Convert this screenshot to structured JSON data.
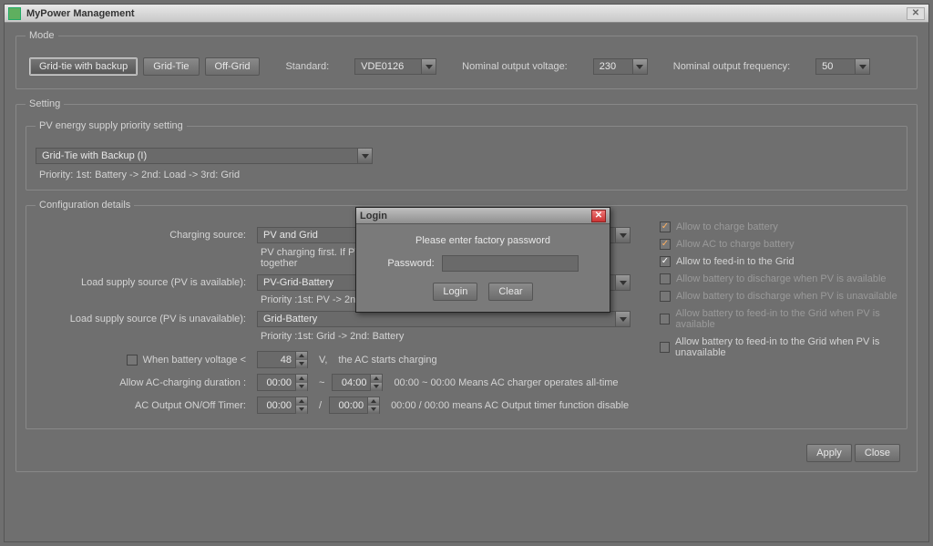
{
  "titlebar": {
    "title": "MyPower Management"
  },
  "mode": {
    "legend": "Mode",
    "buttons": {
      "backup": "Grid-tie with backup",
      "gridtie": "Grid-Tie",
      "offgrid": "Off-Grid"
    },
    "standard_label": "Standard:",
    "standard_value": "VDE0126",
    "voltage_label": "Nominal output voltage:",
    "voltage_value": "230",
    "frequency_label": "Nominal output frequency:",
    "frequency_value": "50"
  },
  "setting": {
    "legend": "Setting",
    "pv_legend": "PV energy supply priority setting",
    "pv_profile": "Grid-Tie with Backup (I)",
    "pv_priority_text": "Priority: 1st: Battery -> 2nd: Load -> 3rd: Grid",
    "config_legend": "Configuration details",
    "charging_source_label": "Charging source:",
    "charging_source_value": "PV and Grid",
    "charging_source_hint": "PV charging first. If PV power is not sufficient, PV and Grid will charge battery together",
    "load_pv_label": "Load supply source (PV is available):",
    "load_pv_value": "PV-Grid-Battery",
    "load_pv_hint": "Priority :1st: PV -> 2nd: Grid -> 3rd: Battery",
    "load_nopv_label": "Load supply source (PV is unavailable):",
    "load_nopv_value": "Grid-Battery",
    "load_nopv_hint": "Priority :1st: Grid -> 2nd: Battery",
    "battery_voltage_label": "When battery voltage <",
    "battery_voltage_value": "48",
    "battery_voltage_unit": "V,",
    "battery_voltage_tail": "the AC starts charging",
    "ac_duration_label": "Allow AC-charging duration :",
    "ac_duration_from": "00:00",
    "ac_duration_sep": "~",
    "ac_duration_to": "04:00",
    "ac_duration_hint": "00:00 ~ 00:00 Means AC charger operates all-time",
    "ac_output_label": "AC Output ON/Off Timer:",
    "ac_output_from": "00:00",
    "ac_output_sep": "/",
    "ac_output_to": "00:00",
    "ac_output_hint": "00:00 / 00:00 means AC Output timer function disable",
    "checkboxes": {
      "charge_batt": "Allow to charge battery",
      "ac_charge_batt": "Allow AC to charge battery",
      "feed_in": "Allow to feed-in to the Grid",
      "batt_disch_pv": "Allow battery to discharge when PV is available",
      "batt_disch_nopv": "Allow battery to discharge when PV is unavailable",
      "batt_feed_pv": "Allow battery to feed-in to the Grid when PV is available",
      "batt_feed_nopv": "Allow battery to feed-in to the Grid when PV is unavailable"
    }
  },
  "footer": {
    "apply": "Apply",
    "close": "Close"
  },
  "dialog": {
    "title": "Login",
    "msg": "Please enter factory password",
    "pw_label": "Password:",
    "login": "Login",
    "clear": "Clear"
  }
}
